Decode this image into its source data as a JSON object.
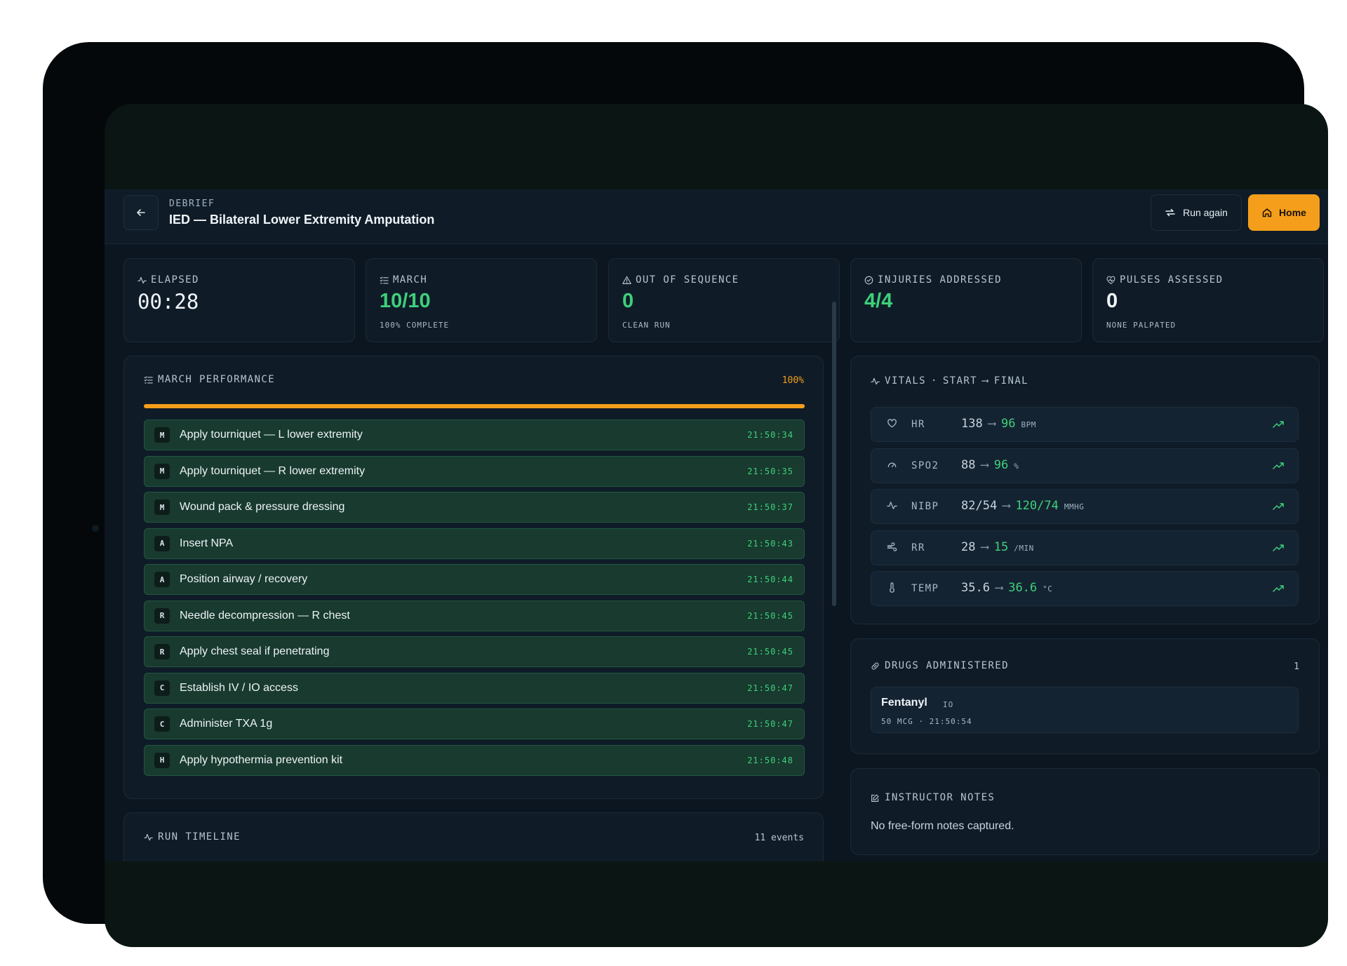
{
  "header": {
    "breadcrumb": "DEBRIEF",
    "title": "IED — Bilateral Lower Extremity Amputation",
    "run_again_label": "Run again",
    "home_label": "Home"
  },
  "stats": [
    {
      "label": "ELAPSED",
      "value": "00:28",
      "sub": ""
    },
    {
      "label": "MARCH",
      "value": "10/10",
      "sub": "100% COMPLETE"
    },
    {
      "label": "OUT OF SEQUENCE",
      "value": "0",
      "sub": "CLEAN RUN"
    },
    {
      "label": "INJURIES ADDRESSED",
      "value": "4/4",
      "sub": ""
    },
    {
      "label": "PULSES ASSESSED",
      "value": "0",
      "sub": "NONE PALPATED"
    }
  ],
  "march": {
    "title": "MARCH PERFORMANCE",
    "percent_label": "100%",
    "progress": 1.0,
    "steps": [
      {
        "letter": "M",
        "text": "Apply tourniquet — L lower extremity",
        "time": "21:50:34"
      },
      {
        "letter": "M",
        "text": "Apply tourniquet — R lower extremity",
        "time": "21:50:35"
      },
      {
        "letter": "M",
        "text": "Wound pack & pressure dressing",
        "time": "21:50:37"
      },
      {
        "letter": "A",
        "text": "Insert NPA",
        "time": "21:50:43"
      },
      {
        "letter": "A",
        "text": "Position airway / recovery",
        "time": "21:50:44"
      },
      {
        "letter": "R",
        "text": "Needle decompression — R chest",
        "time": "21:50:45"
      },
      {
        "letter": "R",
        "text": "Apply chest seal if penetrating",
        "time": "21:50:45"
      },
      {
        "letter": "C",
        "text": "Establish IV / IO access",
        "time": "21:50:47"
      },
      {
        "letter": "C",
        "text": "Administer TXA 1g",
        "time": "21:50:47"
      },
      {
        "letter": "H",
        "text": "Apply hypothermia prevention kit",
        "time": "21:50:48"
      }
    ]
  },
  "timeline": {
    "title": "RUN TIMELINE",
    "count_label": "11 events"
  },
  "vitals": {
    "title_a": "VITALS",
    "title_sep": "·",
    "title_b": "START",
    "title_c": "FINAL",
    "arrow": "⟶",
    "rows": [
      {
        "name": "HR",
        "icon": "heart-icon",
        "start": "138",
        "final": "96",
        "unit": "BPM"
      },
      {
        "name": "SPO2",
        "icon": "gauge-icon",
        "start": "88",
        "final": "96",
        "unit": "%"
      },
      {
        "name": "NIBP",
        "icon": "pulse-icon",
        "start": "82/54",
        "final": "120/74",
        "unit": "MMHG"
      },
      {
        "name": "RR",
        "icon": "wind-icon",
        "start": "28",
        "final": "15",
        "unit": "/MIN"
      },
      {
        "name": "TEMP",
        "icon": "thermometer-icon",
        "start": "35.6",
        "final": "36.6",
        "unit": "°C"
      }
    ]
  },
  "drugs": {
    "title": "DRUGS ADMINISTERED",
    "count": "1",
    "items": [
      {
        "name": "Fentanyl",
        "route": "IO",
        "meta": "50 MCG · 21:50:54"
      }
    ]
  },
  "notes": {
    "title": "INSTRUCTOR NOTES",
    "text": "No free-form notes captured."
  },
  "colors": {
    "accent": "#f59e1b",
    "success": "#3ed07a",
    "background": "#0c1620",
    "card": "#0f1c28",
    "step_fill": "#183a2f"
  }
}
